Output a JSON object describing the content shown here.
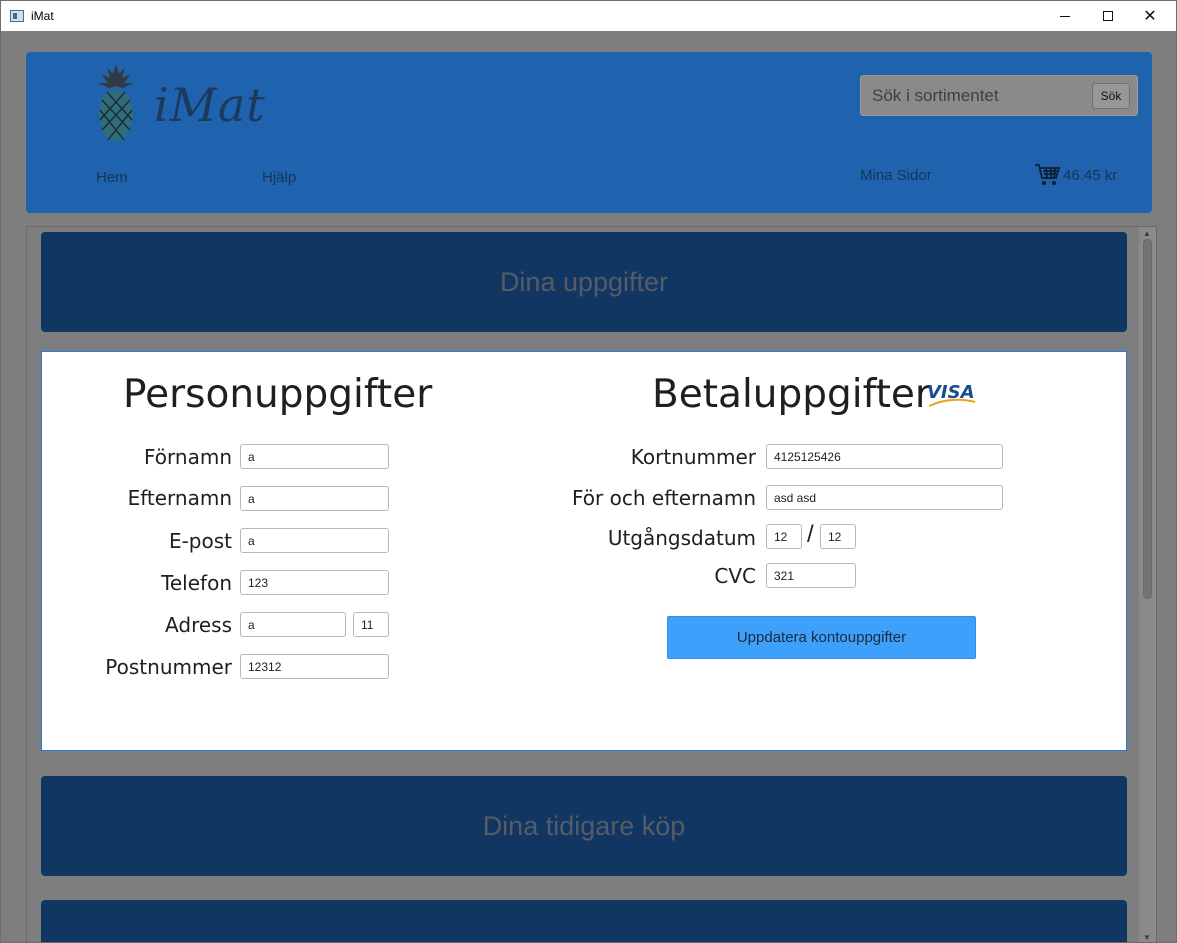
{
  "window": {
    "title": "iMat",
    "minimize_label": "–",
    "maximize_label": "□",
    "close_label": "✕"
  },
  "header": {
    "logo_text": "iMat",
    "search": {
      "placeholder": "Sök i sortimentet",
      "button_label": "Sök"
    },
    "nav": {
      "home": "Hem",
      "help": "Hjälp",
      "my_pages": "Mina Sidor"
    },
    "cart_amount": "46.45 kr"
  },
  "sections": {
    "info_title": "Dina uppgifter",
    "history_title": "Dina tidigare köp"
  },
  "personal": {
    "heading": "Personuppgifter",
    "fields": {
      "firstname": {
        "label": "Förnamn",
        "value": "a"
      },
      "lastname": {
        "label": "Efternamn",
        "value": "a"
      },
      "email": {
        "label": "E-post",
        "value": "a"
      },
      "phone": {
        "label": "Telefon",
        "value": "123"
      },
      "address": {
        "label": "Adress",
        "value": "a",
        "number": "11"
      },
      "postcode": {
        "label": "Postnummer",
        "value": "12312"
      }
    }
  },
  "payment": {
    "heading": "Betaluppgifter",
    "card_brand": "VISA",
    "fields": {
      "card_number": {
        "label": "Kortnummer",
        "value": "4125125426"
      },
      "name": {
        "label": "För och efternamn",
        "value": "asd asd"
      },
      "expiry": {
        "label": "Utgångsdatum",
        "month": "12",
        "separator": "/",
        "year": "12"
      },
      "cvc": {
        "label": "CVC",
        "value": "321"
      }
    },
    "update_button": "Uppdatera kontouppgifter"
  }
}
